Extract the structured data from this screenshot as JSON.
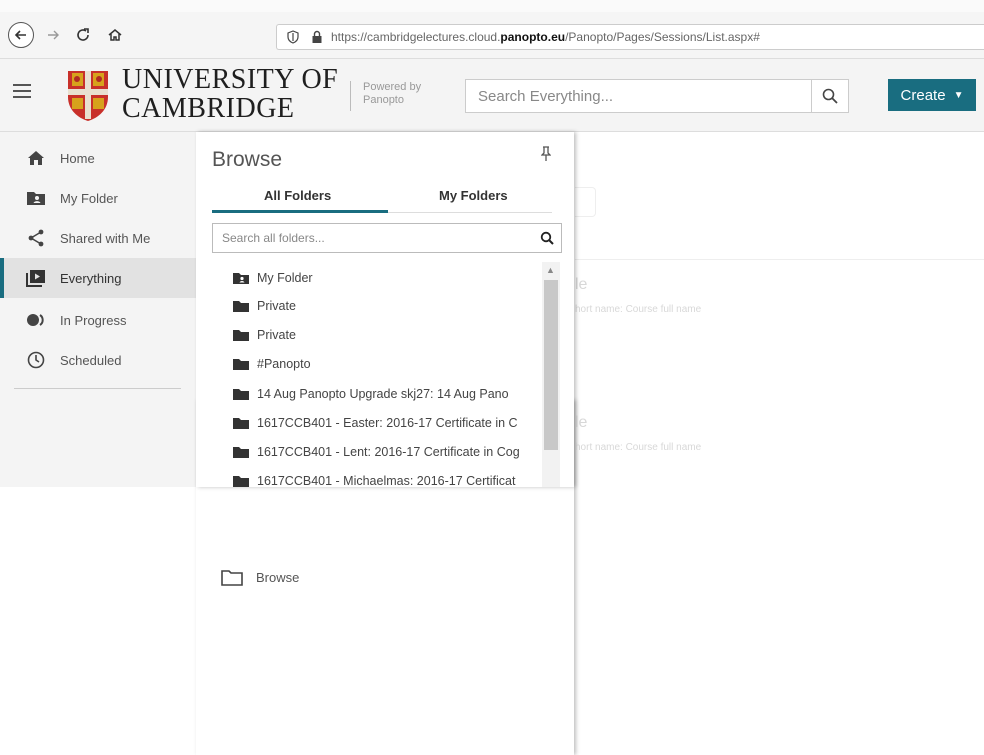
{
  "browser": {
    "url_prefix": "https://cambridgelectures.cloud.",
    "url_domain": "panopto.eu",
    "url_path": "/Panopto/Pages/Sessions/List.aspx#"
  },
  "header": {
    "university_line1": "UNIVERSITY OF",
    "university_line2": "CAMBRIDGE",
    "powered_line1": "Powered by",
    "powered_line2": "Panopto",
    "search_placeholder": "Search Everything...",
    "create_label": "Create",
    "accent_color": "#196d80"
  },
  "sidebar": {
    "items": [
      {
        "label": "Home",
        "icon": "home-icon"
      },
      {
        "label": "My Folder",
        "icon": "user-folder-icon"
      },
      {
        "label": "Shared with Me",
        "icon": "share-icon"
      },
      {
        "label": "Everything",
        "icon": "video-library-icon",
        "active": true
      },
      {
        "label": "In Progress",
        "icon": "in-progress-icon"
      },
      {
        "label": "Scheduled",
        "icon": "clock-icon"
      },
      {
        "label": "Browse",
        "icon": "folder-outline-icon"
      }
    ]
  },
  "browse": {
    "title": "Browse",
    "tabs": [
      "All Folders",
      "My Folders"
    ],
    "active_tab": "All Folders",
    "search_placeholder": "Search all folders...",
    "folders": [
      "My Folder",
      "Private",
      "Private",
      "#Panopto",
      "14 Aug Panopto Upgrade skj27: 14 Aug Pano",
      "1617CCB401 - Easter: 2016-17 Certificate in C",
      "1617CCB401 - Lent: 2016-17 Certificate in Cog",
      "1617CCB401 - Michaelmas: 2016-17 Certificat"
    ]
  },
  "main": {
    "faint_text_1": "le",
    "faint_text_2": "hort name: Course full name",
    "faint_text_3": "le",
    "faint_text_4": "hort name: Course full name"
  }
}
